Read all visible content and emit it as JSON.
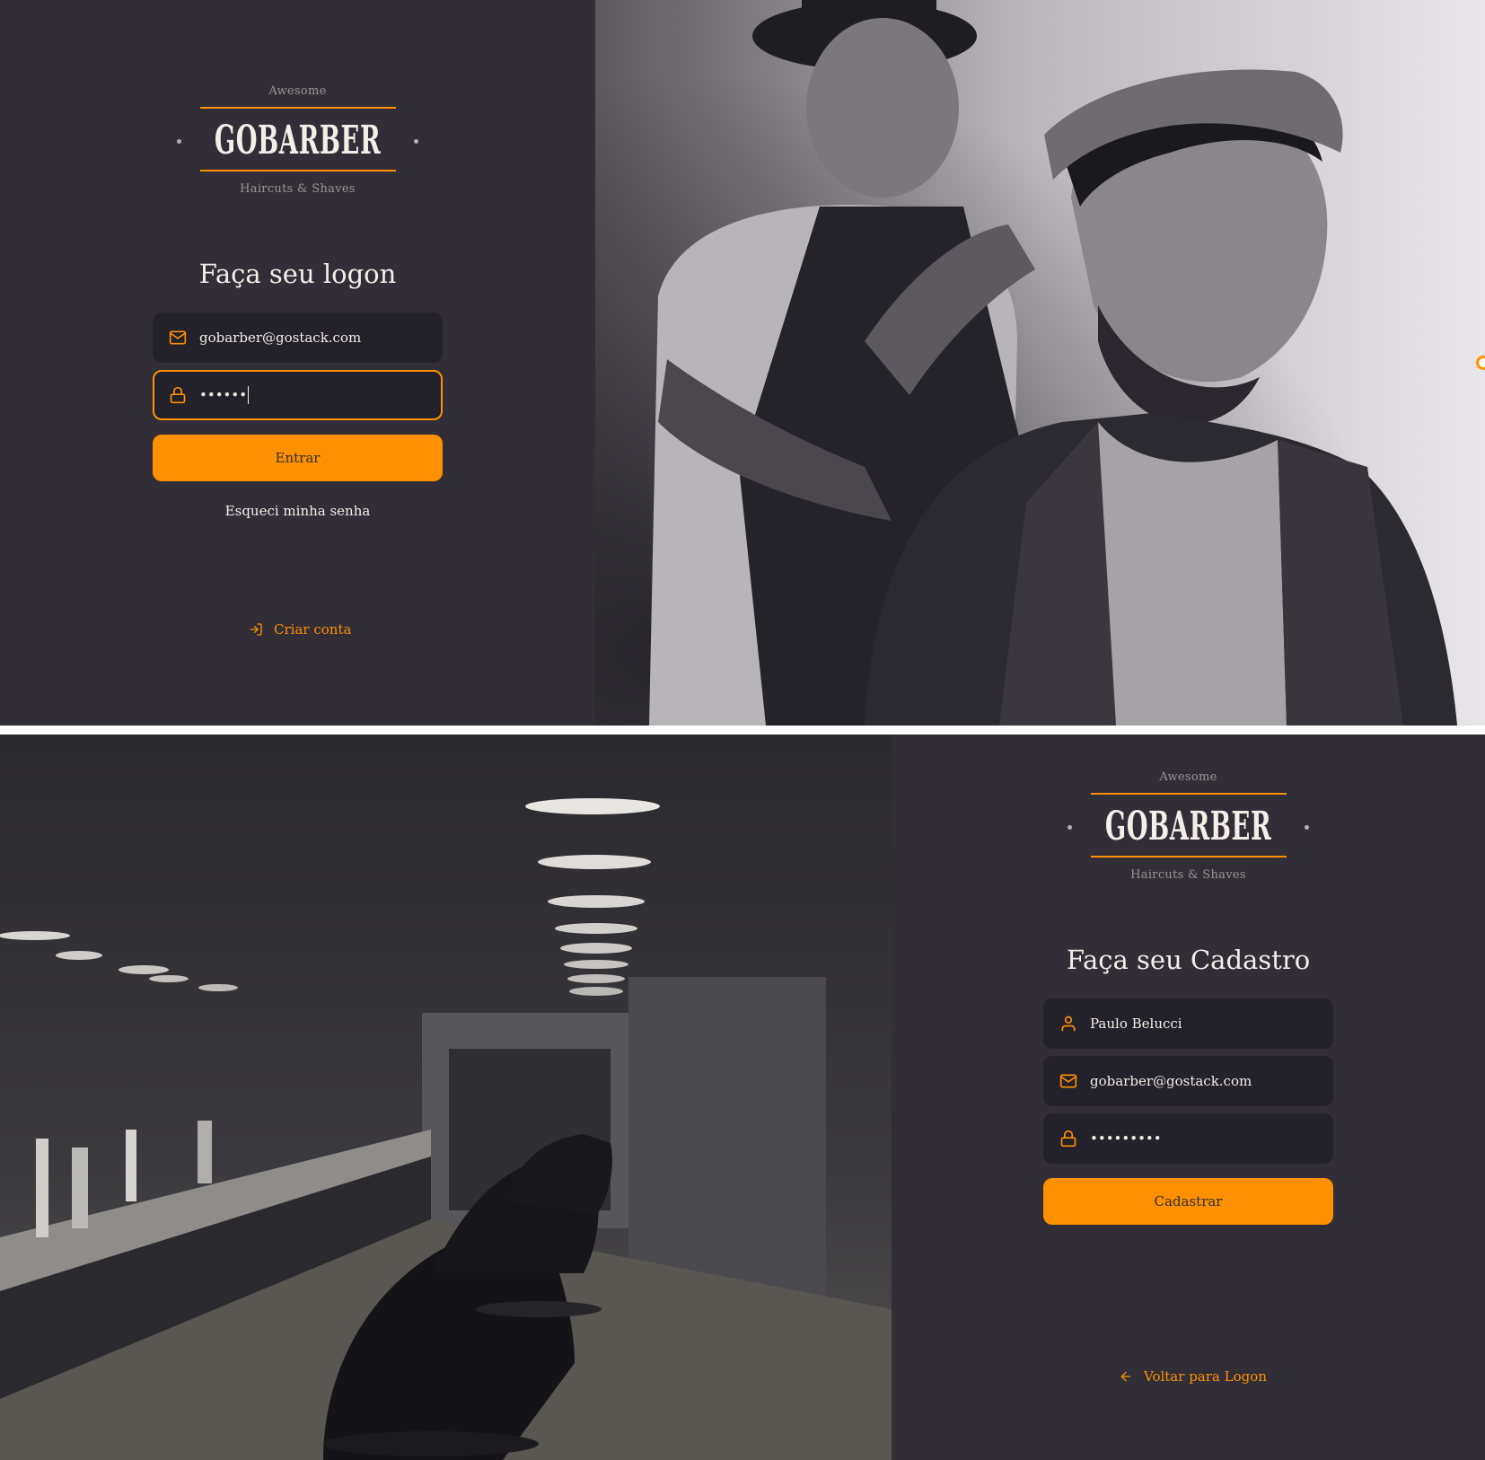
{
  "colors": {
    "background": "#312e38",
    "input_background": "#232129",
    "accent": "#ff9000",
    "text": "#f4ede8",
    "muted": "#999591"
  },
  "logo": {
    "top_text": "Awesome",
    "word": "GOBARBER",
    "bottom_text": "Haircuts & Shaves"
  },
  "login": {
    "title": "Faça seu logon",
    "email": {
      "icon": "mail-icon",
      "value": "gobarber@gostack.com"
    },
    "password": {
      "icon": "lock-icon",
      "value": "••••••"
    },
    "submit_label": "Entrar",
    "forgot_label": "Esqueci minha senha",
    "create_account": {
      "icon": "log-in-icon",
      "label": "Criar conta"
    },
    "photo": "barber-cutting-hair-photo"
  },
  "signup": {
    "title": "Faça seu Cadastro",
    "name": {
      "icon": "user-icon",
      "value": "Paulo Belucci"
    },
    "email": {
      "icon": "mail-icon",
      "value": "gobarber@gostack.com"
    },
    "password": {
      "icon": "lock-icon",
      "value": "•••••••••"
    },
    "submit_label": "Cadastrar",
    "back": {
      "icon": "arrow-left-icon",
      "label": "Voltar para Logon"
    },
    "photo": "barbershop-interior-photo"
  }
}
